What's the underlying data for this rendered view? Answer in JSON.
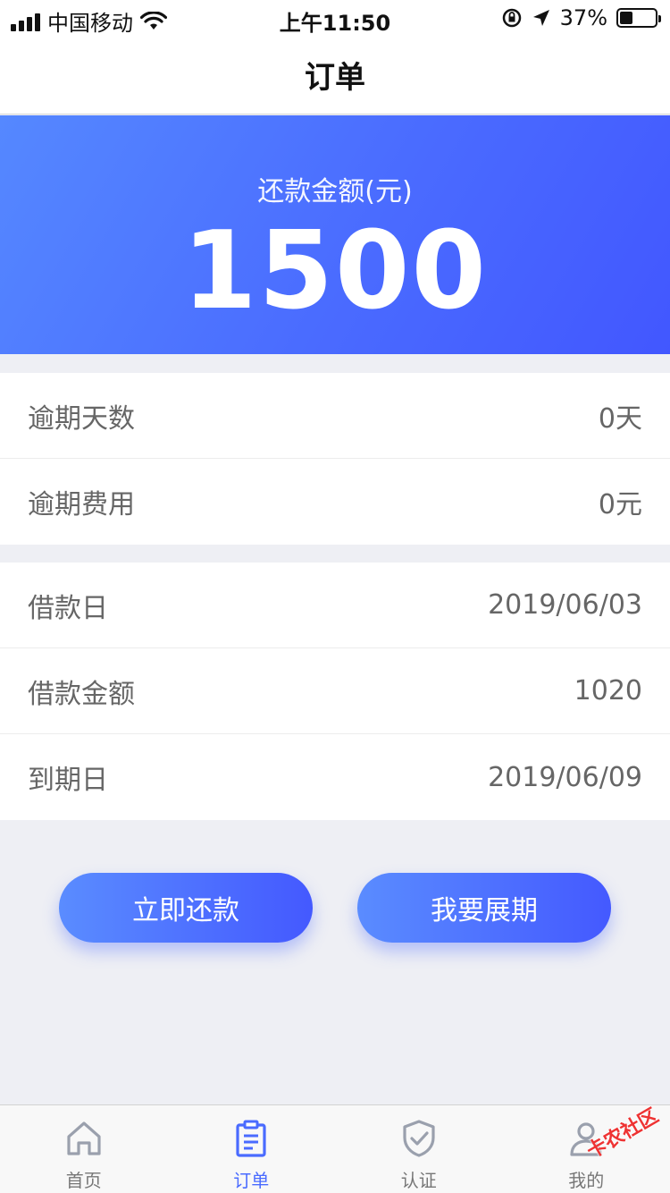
{
  "status_bar": {
    "carrier": "中国移动",
    "time": "上午11:50",
    "battery_percent": "37%",
    "battery_level": 0.37
  },
  "nav": {
    "title": "订单"
  },
  "hero": {
    "label": "还款金额(元)",
    "amount": "1500"
  },
  "overdue_group": [
    {
      "label": "逾期天数",
      "value": "0天"
    },
    {
      "label": "逾期费用",
      "value": "0元"
    }
  ],
  "loan_group": [
    {
      "label": "借款日",
      "value": "2019/06/03"
    },
    {
      "label": "借款金额",
      "value": "1020"
    },
    {
      "label": "到期日",
      "value": "2019/06/09"
    }
  ],
  "actions": {
    "repay_label": "立即还款",
    "extend_label": "我要展期"
  },
  "tabs": [
    {
      "label": "首页",
      "icon": "home-icon",
      "active": false
    },
    {
      "label": "订单",
      "icon": "order-icon",
      "active": true
    },
    {
      "label": "认证",
      "icon": "shield-check-icon",
      "active": false
    },
    {
      "label": "我的",
      "icon": "user-icon",
      "active": false
    }
  ],
  "watermark": "卡农社区",
  "colors": {
    "accent": "#4a6bff",
    "inactive": "#9aa0ad",
    "background": "#eeeff4"
  }
}
